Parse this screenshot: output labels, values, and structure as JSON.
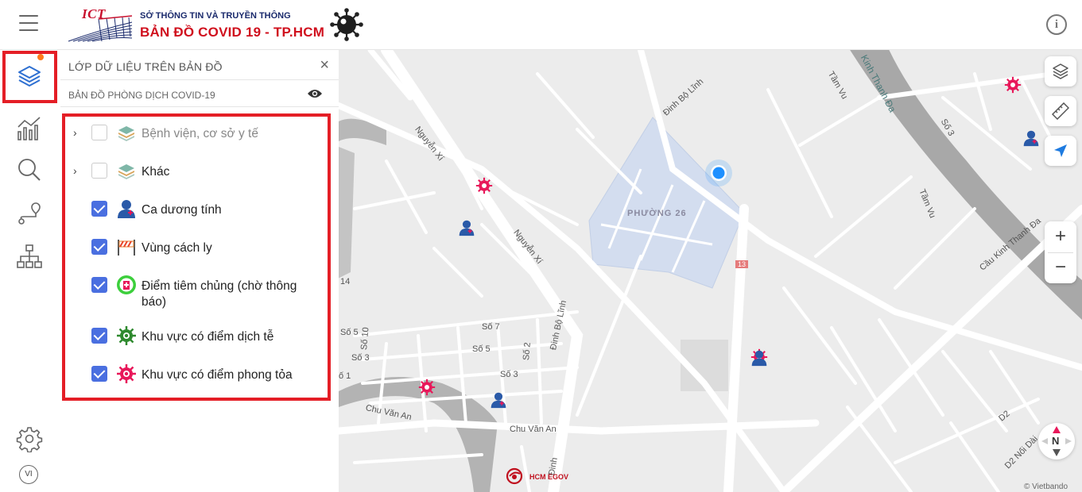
{
  "header": {
    "logo_text": "ICT",
    "subtitle": "SỞ THÔNG TIN VÀ TRUYỀN THÔNG",
    "title": "BẢN ĐỒ  COVID 19 - TP.HCM",
    "info_icon": "info-icon"
  },
  "sidebar": {
    "items": [
      {
        "name": "layers",
        "icon": "layers-icon",
        "active": true,
        "has_notification": true
      },
      {
        "name": "statistics",
        "icon": "chart-icon"
      },
      {
        "name": "search",
        "icon": "search-icon"
      },
      {
        "name": "route",
        "icon": "route-icon"
      },
      {
        "name": "org",
        "icon": "hierarchy-icon"
      }
    ],
    "settings_icon": "gear-icon",
    "language": "VI"
  },
  "panel": {
    "title": "LỚP DỮ LIỆU TRÊN BẢN ĐỒ",
    "subtitle": "BẢN ĐỒ PHÒNG DỊCH COVID-19",
    "layers": [
      {
        "label": "Bệnh viện, cơ sở y tế",
        "checked": false,
        "expandable": true,
        "icon": "stack-icon"
      },
      {
        "label": "Khác",
        "checked": false,
        "expandable": true,
        "icon": "stack-icon"
      },
      {
        "label": "Ca dương tính",
        "checked": true,
        "expandable": false,
        "icon": "patient-icon"
      },
      {
        "label": "Vùng cách ly",
        "checked": true,
        "expandable": false,
        "icon": "barrier-icon"
      },
      {
        "label": "Điểm tiêm chủng (chờ thông báo)",
        "checked": true,
        "expandable": false,
        "icon": "vaccine-icon"
      },
      {
        "label": "Khu vực có điểm dịch tễ",
        "checked": true,
        "expandable": false,
        "icon": "virus-green-icon"
      },
      {
        "label": "Khu vực có điểm phong tỏa",
        "checked": true,
        "expandable": false,
        "icon": "virus-red-icon"
      }
    ]
  },
  "map": {
    "labels": {
      "nguyen_xi_1": "Nguyễn Xí",
      "nguyen_xi_2": "Nguyễn Xí",
      "dinh_bo_linh_1": "Đinh Bộ Lĩnh",
      "dinh_bo_linh_2": "Đinh Bộ Lĩnh",
      "dinh_bo_linh_3": "Đinh",
      "phuong": "PHƯỜNG 26",
      "route": "13",
      "tam_vu_1": "Tầm Vu",
      "tam_vu_2": "Tầm Vu",
      "kinh": "Kinh Thanh Đa",
      "cau": "Cầu Kinh Thanh Đa",
      "so3_top": "Số 3",
      "so7": "Số 7",
      "so5a": "Số 5",
      "so5b": "Số 5",
      "so10": "Số 10",
      "so2": "Số 2",
      "so3a": "Số 3",
      "so3b": "Số 3",
      "so1": "ố 1",
      "n14": "14",
      "chu_van_an_1": "Chu Văn An",
      "chu_van_an_2": "Chu Văn An",
      "d2": "D2",
      "d2_noi_dai": "D2 Nối Dài"
    },
    "egov_label": "HCM EGOV",
    "attribution": "© Vietbando",
    "zoom_in": "+",
    "zoom_out": "−",
    "compass_label": "N",
    "colors": {
      "blockade": "#e8185a",
      "patient": "#2a5aa8",
      "location": "#1e90ff"
    }
  }
}
